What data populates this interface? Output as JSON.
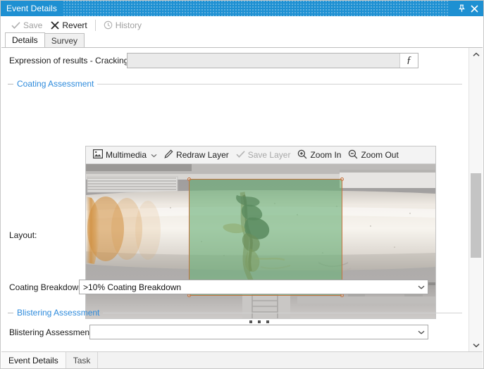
{
  "window": {
    "title": "Event Details",
    "pin_icon": "pin-icon",
    "close_icon": "close-icon"
  },
  "commandbar": {
    "save_label": "Save",
    "save_icon": "check-icon",
    "revert_label": "Revert",
    "revert_icon": "x-icon",
    "history_label": "History",
    "history_icon": "clock-icon"
  },
  "tabs": [
    {
      "label": "Details",
      "active": true
    },
    {
      "label": "Survey",
      "active": false
    }
  ],
  "form": {
    "expression_label": "Expression of results - Cracking:",
    "expression_value": "",
    "expression_placeholder": "",
    "fx_label": "ƒ",
    "layout_label": "Layout:"
  },
  "groups": {
    "coating": "Coating Assessment",
    "blistering": "Blistering Assessment"
  },
  "media_toolbar": {
    "multimedia_label": "Multimedia",
    "multimedia_icon": "picture-icon",
    "multimedia_caret": "chevron-down-icon",
    "redraw_label": "Redraw Layer",
    "redraw_icon": "pencil-icon",
    "save_layer_label": "Save Layer",
    "save_layer_icon": "check-icon",
    "zoom_in_label": "Zoom In",
    "zoom_in_icon": "magnifier-plus-icon",
    "zoom_out_label": "Zoom Out",
    "zoom_out_icon": "magnifier-minus-icon"
  },
  "media": {
    "alt": "Photograph of a corroded industrial pipe with rust streaks and a green annotation overlay",
    "overlay_color": "#6ab078",
    "overlay_border_color": "#c4713c"
  },
  "fields": {
    "coating_breakdown_label": "Coating Breakdown:",
    "coating_breakdown_value": ">10% Coating Breakdown",
    "blistering_label": "Blistering Assessment:",
    "blistering_value": ""
  },
  "scrollbar": {
    "up_icon": "chevron-up-icon",
    "down_icon": "chevron-down-icon"
  },
  "bottom_tabs": [
    {
      "label": "Event Details",
      "active": true
    },
    {
      "label": "Task",
      "active": false
    }
  ],
  "colors": {
    "title_bar": "#1e90d2",
    "group_heading": "#2e8bdc",
    "overlay_green": "#6ab078",
    "overlay_orange": "#c4713c"
  }
}
